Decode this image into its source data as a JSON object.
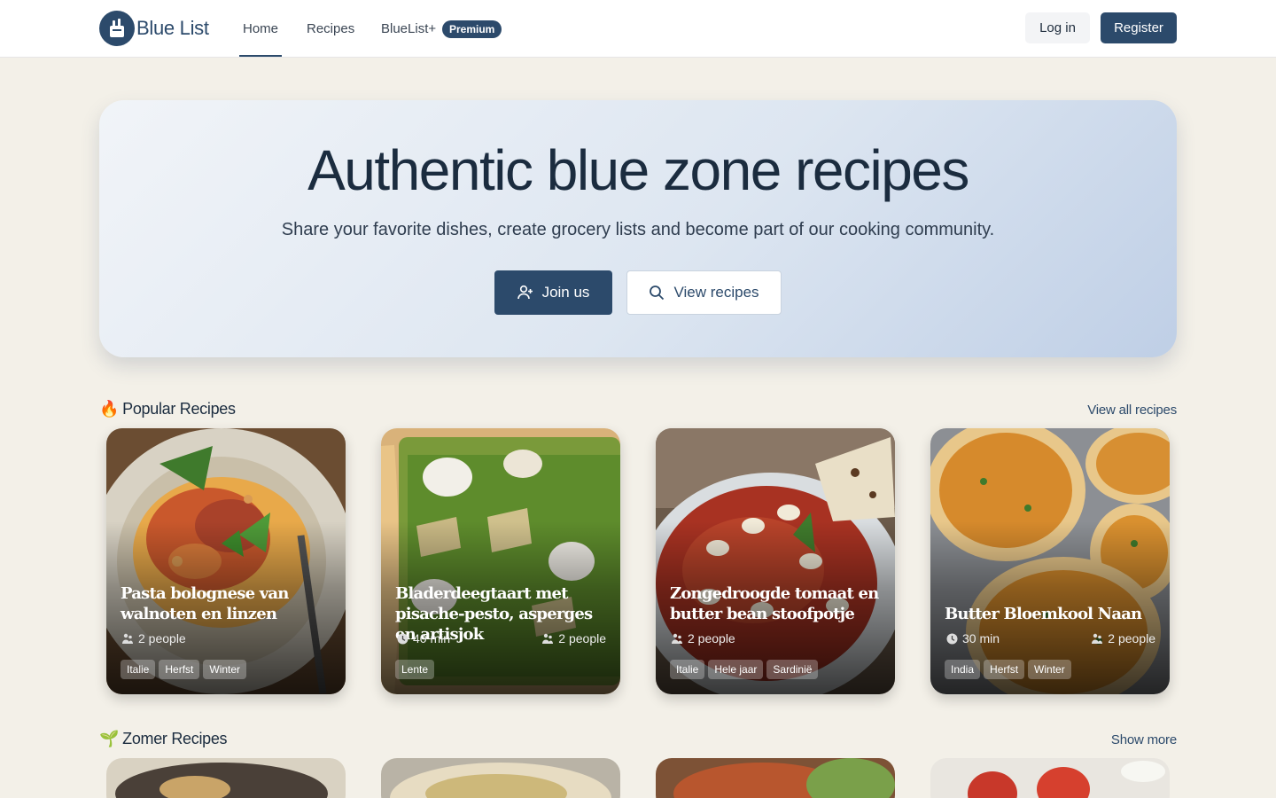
{
  "nav": {
    "brand": "Blue List",
    "home": "Home",
    "recipes": "Recipes",
    "blueplus": "BlueList+",
    "premium": "Premium",
    "login": "Log in",
    "register": "Register"
  },
  "hero": {
    "title": "Authentic blue zone recipes",
    "subtitle": "Share your favorite dishes, create grocery lists and become part of our cooking community.",
    "join": "Join us",
    "view": "View recipes"
  },
  "popular": {
    "icon": "🔥",
    "title": "Popular Recipes",
    "link": "View all recipes",
    "cards": [
      {
        "title": "Pasta bolognese van walnoten en linzen",
        "time": "",
        "people": "2 people",
        "tags": [
          "Italie",
          "Herfst",
          "Winter"
        ]
      },
      {
        "title": "Bladerdeegtaart met pisache-pesto, asperges en artisjok",
        "time": "40 min",
        "people": "2 people",
        "tags": [
          "Lente"
        ]
      },
      {
        "title": "Zongedroogde tomaat en butter bean stoofpotje",
        "time": "",
        "people": "2 people",
        "tags": [
          "Italie",
          "Hele jaar",
          "Sardinië"
        ]
      },
      {
        "title": "Butter Bloemkool Naan",
        "time": "30 min",
        "people": "2 people",
        "tags": [
          "India",
          "Herfst",
          "Winter"
        ]
      }
    ]
  },
  "zomer": {
    "icon": "🌱",
    "title": "Zomer Recipes",
    "link": "Show more"
  },
  "colors": {
    "accent": "#2c4a6b",
    "page_bg": "#f3f0e8"
  },
  "icons": [
    "logo-basket-icon",
    "user-plus-icon",
    "search-icon",
    "clock-icon",
    "people-icon",
    "fire-icon",
    "seedling-icon"
  ]
}
